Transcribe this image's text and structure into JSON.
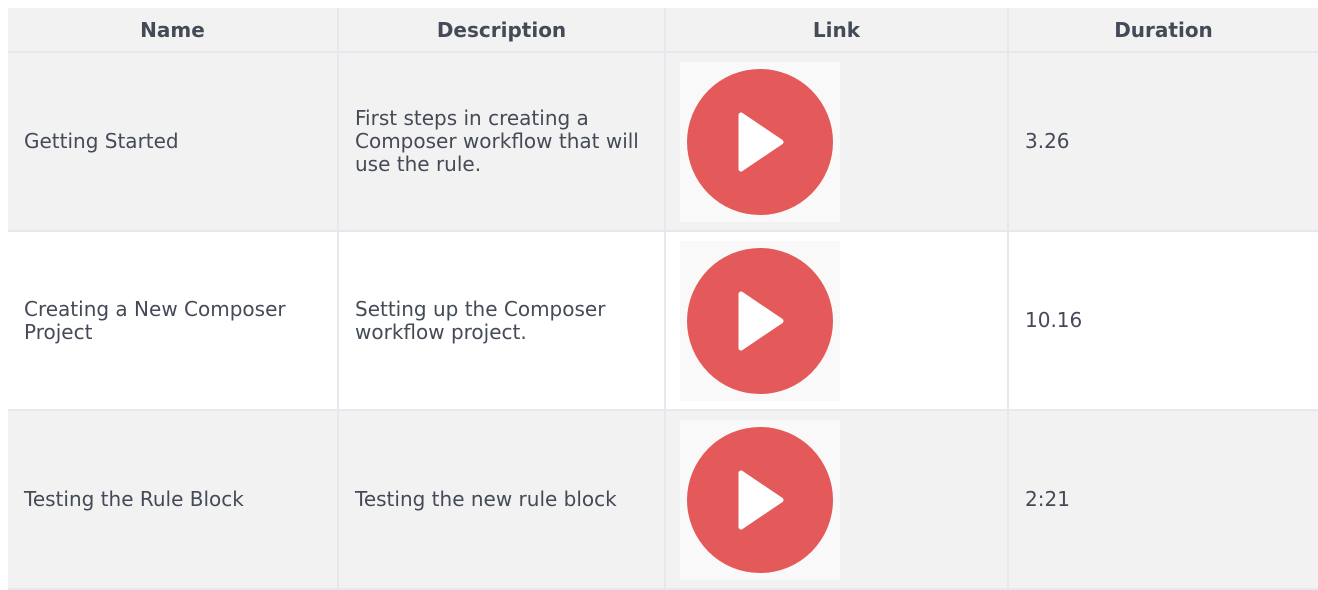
{
  "table": {
    "headers": [
      "Name",
      "Description",
      "Link",
      "Duration"
    ],
    "rows": [
      {
        "name": "Getting Started",
        "description": "First steps in creating a Composer workflow that will use the rule.",
        "link_icon": "play-icon",
        "duration": "3.26"
      },
      {
        "name": "Creating a New Composer Project",
        "description": "Setting up the Composer workflow project.",
        "link_icon": "play-icon",
        "duration": "10.16"
      },
      {
        "name": "Testing the Rule Block",
        "description": "Testing the new rule block",
        "link_icon": "play-icon",
        "duration": "2:21"
      }
    ]
  },
  "colors": {
    "play_button": "#e45a5a",
    "header_background": "#f2f2f2",
    "text": "#454a57"
  }
}
